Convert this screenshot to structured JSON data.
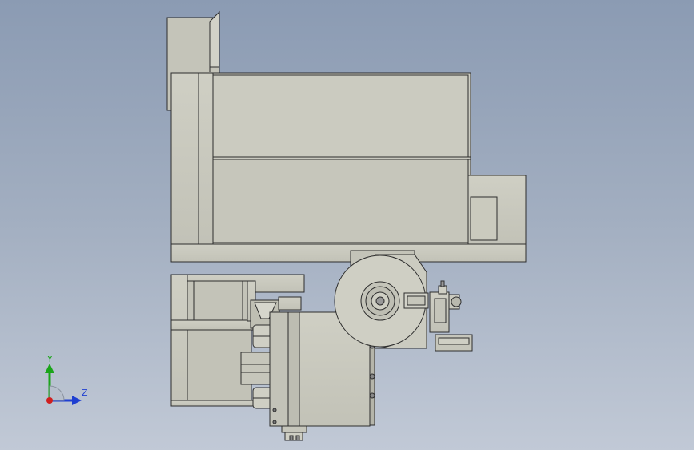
{
  "colors": {
    "background_top": "#8b9bb3",
    "background_bottom": "#c1c9d6",
    "part_fill": "#c8c8bd",
    "part_shade": "#b9b9ae",
    "edge": "#2d2d2d",
    "axis_y": "#1aa51a",
    "axis_z": "#1f3fd1",
    "axis_x": "#d01f1f"
  },
  "triad": {
    "y_label": "Y",
    "z_label": "Z"
  }
}
